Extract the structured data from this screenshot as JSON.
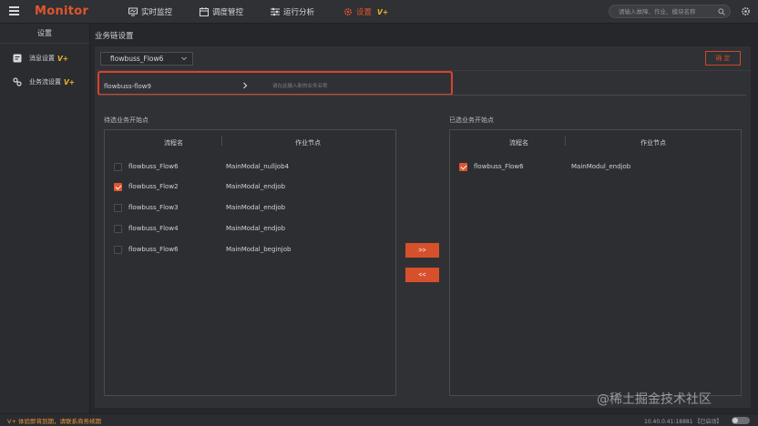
{
  "app": {
    "logo": "Monitor",
    "vplus": "V+"
  },
  "nav": [
    {
      "label": "实时监控",
      "icon": "monitor-icon"
    },
    {
      "label": "调度管控",
      "icon": "calendar-icon"
    },
    {
      "label": "运行分析",
      "icon": "sliders-icon"
    },
    {
      "label": "设置",
      "icon": "gear-icon",
      "active": true,
      "badge": "V+"
    }
  ],
  "search": {
    "placeholder": "请输入故障、作业、模块名称"
  },
  "sidebar": {
    "title": "设置",
    "items": [
      {
        "label": "消息设置",
        "badge": "V+",
        "icon": "message-icon"
      },
      {
        "label": "业务流设置",
        "badge": "V+",
        "icon": "link-icon"
      }
    ]
  },
  "page": {
    "title": "业务链设置",
    "flow_select": "flowbuss_Flow6",
    "confirm_label": "确 定",
    "chain_name": "flowbuss-flow9",
    "chain_placeholder": "请在此输入新的业务名称"
  },
  "left_list": {
    "label": "待选业务开始点",
    "columns": [
      "流程名",
      "作业节点"
    ],
    "rows": [
      {
        "checked": false,
        "flow": "flowbuss_Flow6",
        "node": "MainModal_nulljob4"
      },
      {
        "checked": true,
        "flow": "flowbuss_Flow2",
        "node": "MainModal_endjob"
      },
      {
        "checked": false,
        "flow": "flowbuss_Flow3",
        "node": "MainModal_endjob"
      },
      {
        "checked": false,
        "flow": "flowbuss_Flow4",
        "node": "MainModal_endjob"
      },
      {
        "checked": false,
        "flow": "flowbuss_Flow6",
        "node": "MainModal_beginjob"
      }
    ]
  },
  "right_list": {
    "label": "已选业务开始点",
    "columns": [
      "流程名",
      "作业节点"
    ],
    "rows": [
      {
        "checked": true,
        "flow": "flowbuss_Flow6",
        "node": "MainModul_endjob"
      }
    ]
  },
  "buttons": {
    "move_right": ">>",
    "move_left": "<<"
  },
  "status": {
    "left": "V+ 体验即将到期，请联系商务续期",
    "right": "10.40.0.41:18881 【已启动】"
  },
  "watermark": "@稀土掘金技术社区",
  "colors": {
    "accent": "#e2552e",
    "vplus": "#f0b323",
    "highlight": "#d9432a"
  }
}
